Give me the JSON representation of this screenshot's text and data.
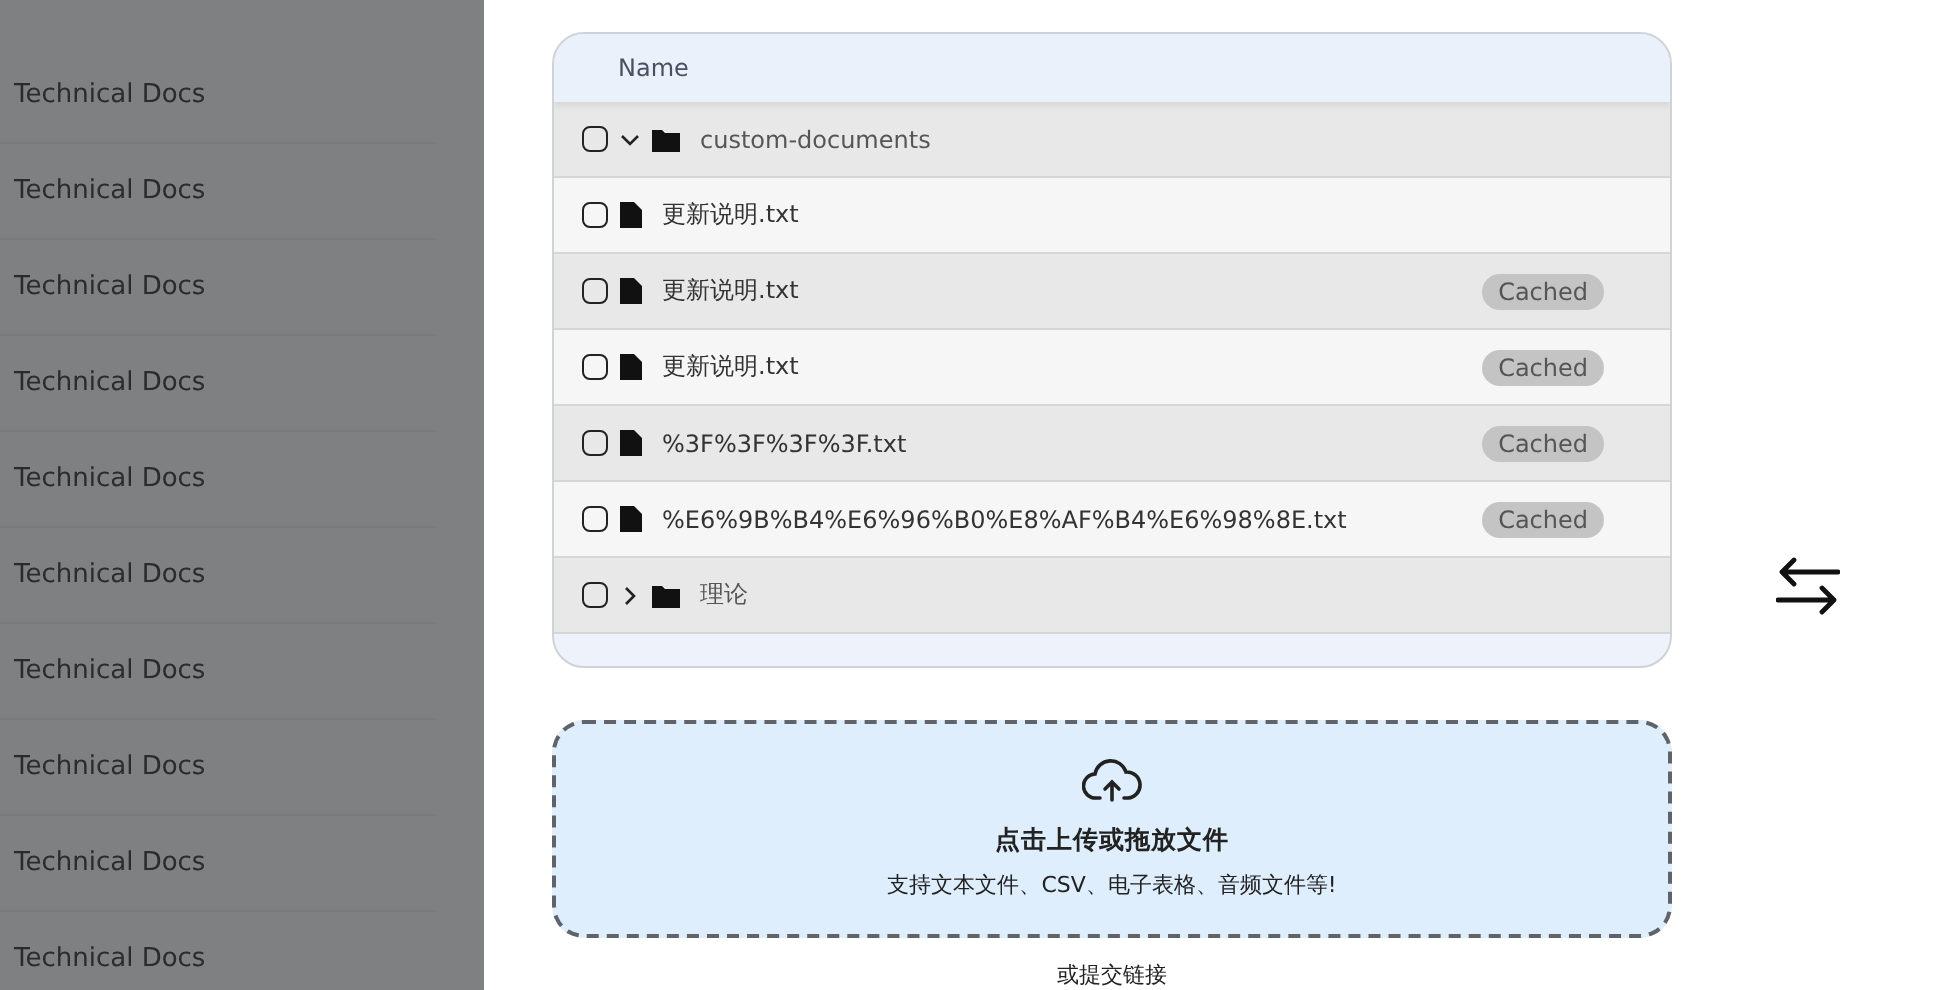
{
  "sidebar": {
    "items": [
      "Technical Docs",
      "Technical Docs",
      "Technical Docs",
      "Technical Docs",
      "Technical Docs",
      "Technical Docs",
      "Technical Docs",
      "Technical Docs",
      "Technical Docs",
      "Technical Docs"
    ]
  },
  "file_table": {
    "columns": [
      "Name"
    ],
    "rows": [
      {
        "kind": "folder",
        "name": "custom-documents",
        "checked": false,
        "expanded": true
      },
      {
        "kind": "file",
        "name": "更新说明.txt",
        "checked": false
      },
      {
        "kind": "file",
        "name": "更新说明.txt",
        "checked": false,
        "badge": "Cached"
      },
      {
        "kind": "file",
        "name": "更新说明.txt",
        "checked": false,
        "badge": "Cached"
      },
      {
        "kind": "file",
        "name": "%3F%3F%3F%3F.txt",
        "checked": false,
        "badge": "Cached"
      },
      {
        "kind": "file",
        "name": "%E6%9B%B4%E6%96%B0%E8%AF%B4%E6%98%8E.txt",
        "checked": false,
        "badge": "Cached"
      },
      {
        "kind": "folder",
        "name": "理论",
        "checked": false,
        "expanded": false
      }
    ]
  },
  "upload": {
    "title": "点击上传或拖放文件",
    "subtitle": "支持文本文件、CSV、电子表格、音频文件等!"
  },
  "link_label": "或提交链接"
}
